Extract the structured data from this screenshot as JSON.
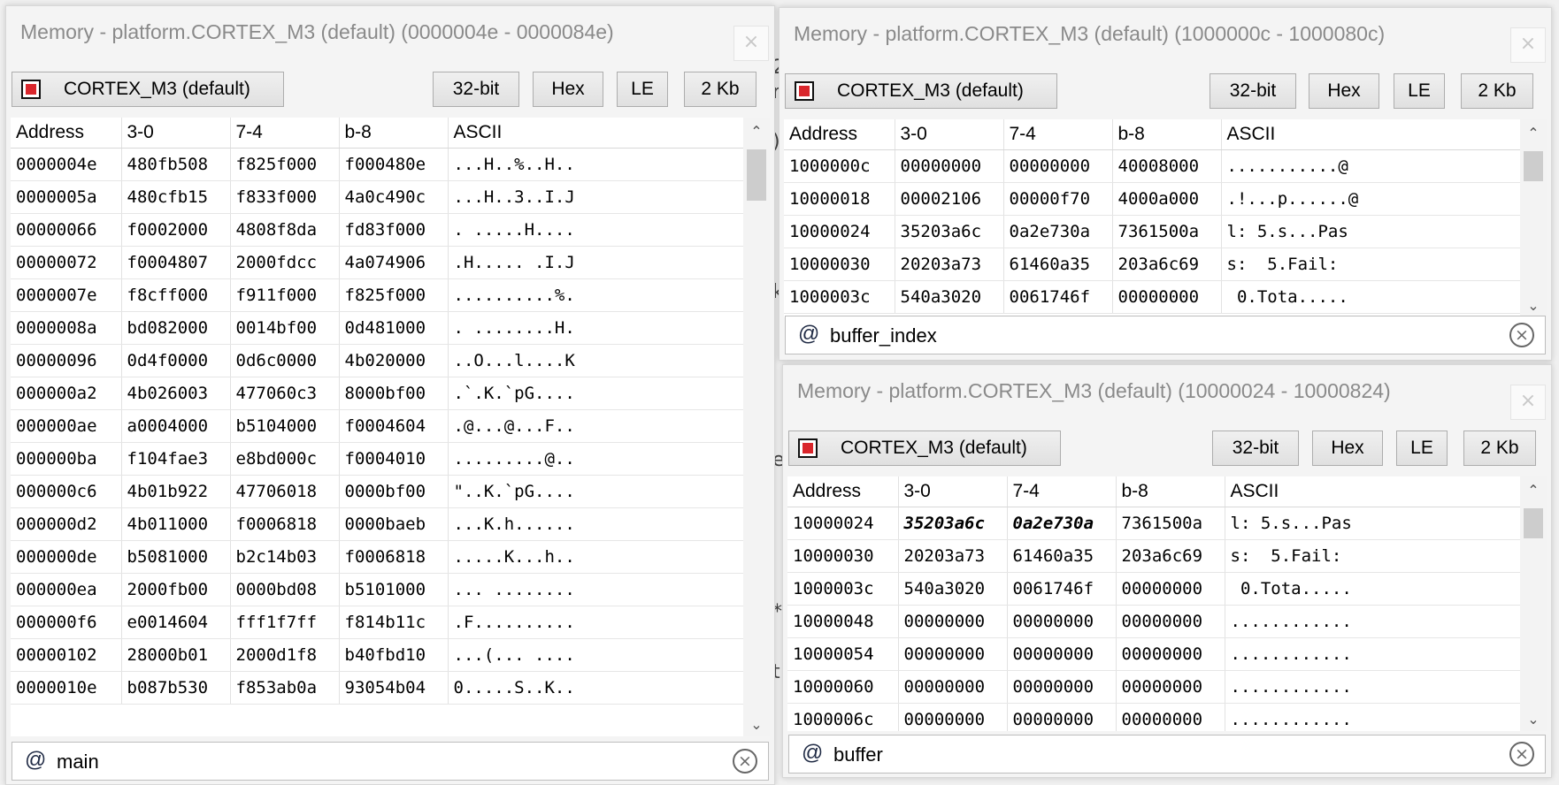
{
  "colors": {
    "chip_red": "#d9262c",
    "accent_border": "#adadad"
  },
  "windows": [
    {
      "title": "Memory - platform.CORTEX_M3 (default) (0000004e - 0000084e)",
      "close": "×",
      "toolbar": {
        "processor": "CORTEX_M3 (default)",
        "width": "32-bit",
        "format": "Hex",
        "endian": "LE",
        "size": "2 Kb"
      },
      "columns": [
        "Address",
        "3-0",
        "7-4",
        "b-8",
        "ASCII"
      ],
      "rows": [
        [
          "0000004e",
          "480fb508",
          "f825f000",
          "f000480e",
          "...H..%..H.."
        ],
        [
          "0000005a",
          "480cfb15",
          "f833f000",
          "4a0c490c",
          "...H..3..I.J"
        ],
        [
          "00000066",
          "f0002000",
          "4808f8da",
          "fd83f000",
          ". .....H...."
        ],
        [
          "00000072",
          "f0004807",
          "2000fdcc",
          "4a074906",
          ".H..... .I.J"
        ],
        [
          "0000007e",
          "f8cff000",
          "f911f000",
          "f825f000",
          "..........%."
        ],
        [
          "0000008a",
          "bd082000",
          "0014bf00",
          "0d481000",
          ". ........H."
        ],
        [
          "00000096",
          "0d4f0000",
          "0d6c0000",
          "4b020000",
          "..O...l....K"
        ],
        [
          "000000a2",
          "4b026003",
          "477060c3",
          "8000bf00",
          ".`.K.`pG...."
        ],
        [
          "000000ae",
          "a0004000",
          "b5104000",
          "f0004604",
          ".@...@...F.."
        ],
        [
          "000000ba",
          "f104fae3",
          "e8bd000c",
          "f0004010",
          ".........@.."
        ],
        [
          "000000c6",
          "4b01b922",
          "47706018",
          "0000bf00",
          "\"..K.`pG...."
        ],
        [
          "000000d2",
          "4b011000",
          "f0006818",
          "0000baeb",
          "...K.h......"
        ],
        [
          "000000de",
          "b5081000",
          "b2c14b03",
          "f0006818",
          ".....K...h.."
        ],
        [
          "000000ea",
          "2000fb00",
          "0000bd08",
          "b5101000",
          "... ........"
        ],
        [
          "000000f6",
          "e0014604",
          "fff1f7ff",
          "f814b11c",
          ".F.........."
        ],
        [
          "00000102",
          "28000b01",
          "2000d1f8",
          "b40fbd10",
          "...(... ...."
        ],
        [
          "0000010e",
          "b087b530",
          "f853ab0a",
          "93054b04",
          "0.....S..K.."
        ]
      ],
      "filter": {
        "icon": "@",
        "value": "main",
        "clear": "×"
      }
    },
    {
      "title": "Memory - platform.CORTEX_M3 (default) (1000000c - 1000080c)",
      "close": "×",
      "toolbar": {
        "processor": "CORTEX_M3 (default)",
        "width": "32-bit",
        "format": "Hex",
        "endian": "LE",
        "size": "2 Kb"
      },
      "columns": [
        "Address",
        "3-0",
        "7-4",
        "b-8",
        "ASCII"
      ],
      "rows": [
        [
          "1000000c",
          "00000000",
          "00000000",
          "40008000",
          "...........@"
        ],
        [
          "10000018",
          "00002106",
          "00000f70",
          "4000a000",
          ".!...p......@"
        ],
        [
          "10000024",
          "35203a6c",
          "0a2e730a",
          "7361500a",
          "l: 5.s...Pas"
        ],
        [
          "10000030",
          "20203a73",
          "61460a35",
          "203a6c69",
          "s:  5.Fail:"
        ],
        [
          "1000003c",
          "540a3020",
          "0061746f",
          "00000000",
          " 0.Tota....."
        ]
      ],
      "filter": {
        "icon": "@",
        "value": "buffer_index",
        "clear": "×"
      }
    },
    {
      "title": "Memory - platform.CORTEX_M3 (default) (10000024 - 10000824)",
      "close": "×",
      "toolbar": {
        "processor": "CORTEX_M3 (default)",
        "width": "32-bit",
        "format": "Hex",
        "endian": "LE",
        "size": "2 Kb"
      },
      "columns": [
        "Address",
        "3-0",
        "7-4",
        "b-8",
        "ASCII"
      ],
      "rows": [
        [
          "10000024",
          "35203a6c",
          "0a2e730a",
          "7361500a",
          "l: 5.s...Pas"
        ],
        [
          "10000030",
          "20203a73",
          "61460a35",
          "203a6c69",
          "s:  5.Fail:"
        ],
        [
          "1000003c",
          "540a3020",
          "0061746f",
          "00000000",
          " 0.Tota....."
        ],
        [
          "10000048",
          "00000000",
          "00000000",
          "00000000",
          "............"
        ],
        [
          "10000054",
          "00000000",
          "00000000",
          "00000000",
          "............"
        ],
        [
          "10000060",
          "00000000",
          "00000000",
          "00000000",
          "............"
        ],
        [
          "1000006c",
          "00000000",
          "00000000",
          "00000000",
          "............"
        ]
      ],
      "filter": {
        "icon": "@",
        "value": "buffer",
        "clear": "×"
      }
    }
  ]
}
